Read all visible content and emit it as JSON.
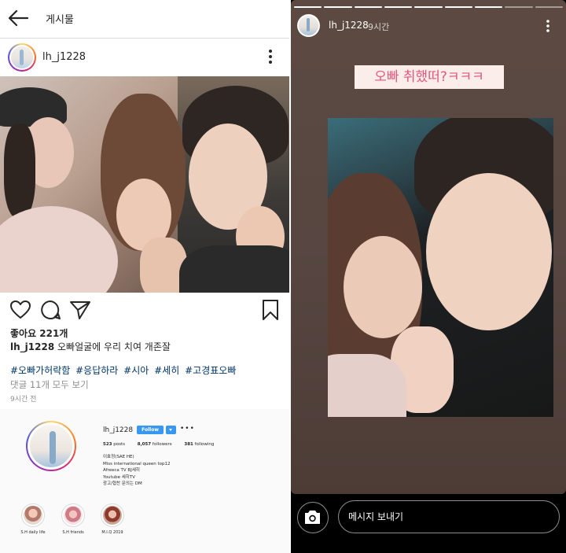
{
  "post_view": {
    "header": {
      "title": "게시물"
    },
    "post": {
      "username": "lh_j1228",
      "likes_text": "좋아요 221개",
      "caption_username": "lh_j1228",
      "caption_text": "오빠얼굴에 우리 치여 개존잘",
      "hashtags": [
        "#오빠가허락함",
        "#응답하라",
        "#시아",
        "#세히",
        "#고경표오빠"
      ],
      "view_comments": "댓글 11개 모두 보기",
      "time_ago": "9시간 전"
    },
    "profile_card": {
      "username": "lh_j1228",
      "follow_label": "Follow",
      "more_label": "•••",
      "stats": {
        "posts_count": "523",
        "posts_label": "posts",
        "followers_count": "8,057",
        "followers_label": "followers",
        "following_count": "381",
        "following_label": "following"
      },
      "bio_lines": [
        "이효정(SAE HE)",
        "Miss international queen top12",
        "Afreeca TV BJ세히",
        "Youtube 세히TV",
        "광고/협찬 문의는 DM"
      ],
      "highlights": [
        {
          "label": "S.H daily life"
        },
        {
          "label": "S.H friends"
        },
        {
          "label": "M.I.Q 2019"
        }
      ]
    },
    "icons": [
      "back-arrow-icon",
      "more-vertical-icon",
      "heart-icon",
      "comment-icon",
      "share-icon",
      "bookmark-icon"
    ]
  },
  "story_view": {
    "username": "lh_j1228",
    "time": "9시간",
    "sticker_text": "오빠 취했떠?ㅋㅋㅋ",
    "reply_placeholder": "메시지 보내기",
    "progress_segments": 9,
    "progress_completed": 7,
    "icons": [
      "more-vertical-icon",
      "camera-icon"
    ]
  },
  "colors": {
    "link": "#003569",
    "follow_button": "#3897f0",
    "sticker_text": "#e4577a",
    "sticker_bg": "#fbeeea",
    "muted_text": "#8e8e8e"
  }
}
